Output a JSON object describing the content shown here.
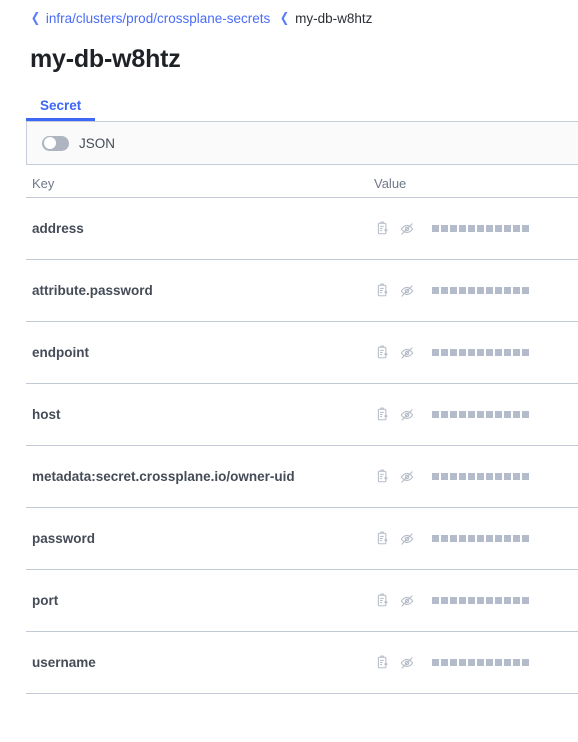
{
  "breadcrumb": {
    "chevron_icon": "chevron-left-icon",
    "parent": "infra/clusters/prod/crossplane-secrets",
    "current": "my-db-w8htz"
  },
  "page": {
    "title": "my-db-w8htz"
  },
  "tabs": [
    {
      "label": "Secret",
      "active": true
    }
  ],
  "toolbar": {
    "json_toggle": {
      "label": "JSON",
      "state": "off",
      "icon": "toggle-off-icon"
    }
  },
  "table": {
    "columns": {
      "key": "Key",
      "value": "Value"
    },
    "row_icons": {
      "copy": "copy-clipboard-icon",
      "reveal": "eye-slash-icon"
    },
    "masked_char_count": 11,
    "rows": [
      {
        "key": "address",
        "value_masked": true
      },
      {
        "key": "attribute.password",
        "value_masked": true
      },
      {
        "key": "endpoint",
        "value_masked": true
      },
      {
        "key": "host",
        "value_masked": true
      },
      {
        "key": "metadata:secret.crossplane.io/owner-uid",
        "value_masked": true
      },
      {
        "key": "password",
        "value_masked": true
      },
      {
        "key": "port",
        "value_masked": true
      },
      {
        "key": "username",
        "value_masked": true
      }
    ]
  },
  "colors": {
    "accent": "#3d68f5",
    "link": "#4a6cf7",
    "text": "#454c57",
    "title": "#1e2126",
    "muted": "#70788a",
    "border": "#c3cad6",
    "panel_bg": "#fafafb",
    "mask": "#b4bbca",
    "toggle_off": "#aeb4c0"
  }
}
